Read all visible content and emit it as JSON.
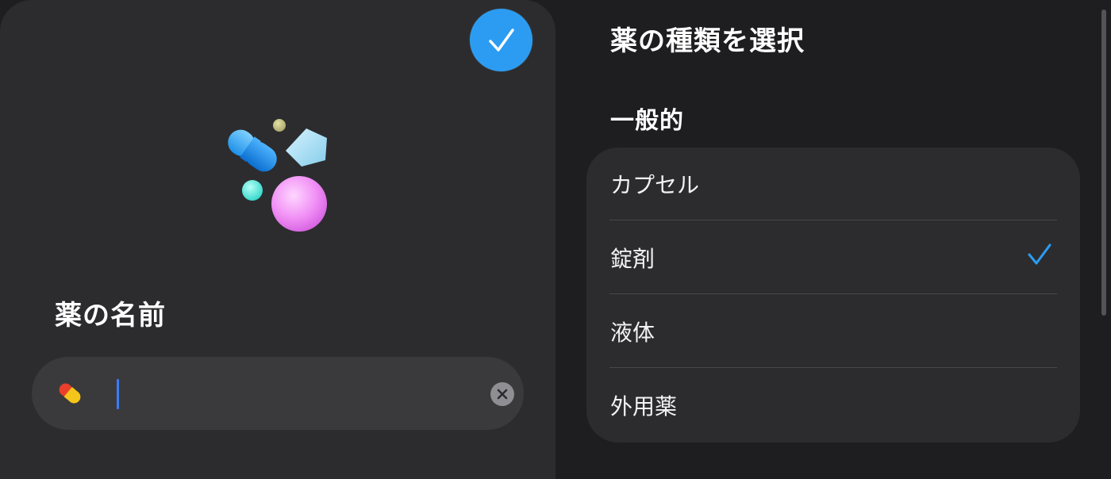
{
  "left": {
    "name_heading": "薬の名前",
    "name_input_value": "",
    "done_icon": "checkmark-icon",
    "clear_icon": "clear-x-icon",
    "field_icon": "pill-emoji-icon",
    "illustration": "medications-illustration"
  },
  "right": {
    "heading": "薬の種類を選択",
    "section_heading": "一般的",
    "options": [
      {
        "label": "カプセル",
        "selected": false
      },
      {
        "label": "錠剤",
        "selected": true
      },
      {
        "label": "液体",
        "selected": false
      },
      {
        "label": "外用薬",
        "selected": false
      }
    ]
  },
  "colors": {
    "accent": "#2c9cf2",
    "checkmark": "#2c9cf2",
    "card_bg": "#2c2c2e",
    "page_bg": "#1e1e20"
  }
}
